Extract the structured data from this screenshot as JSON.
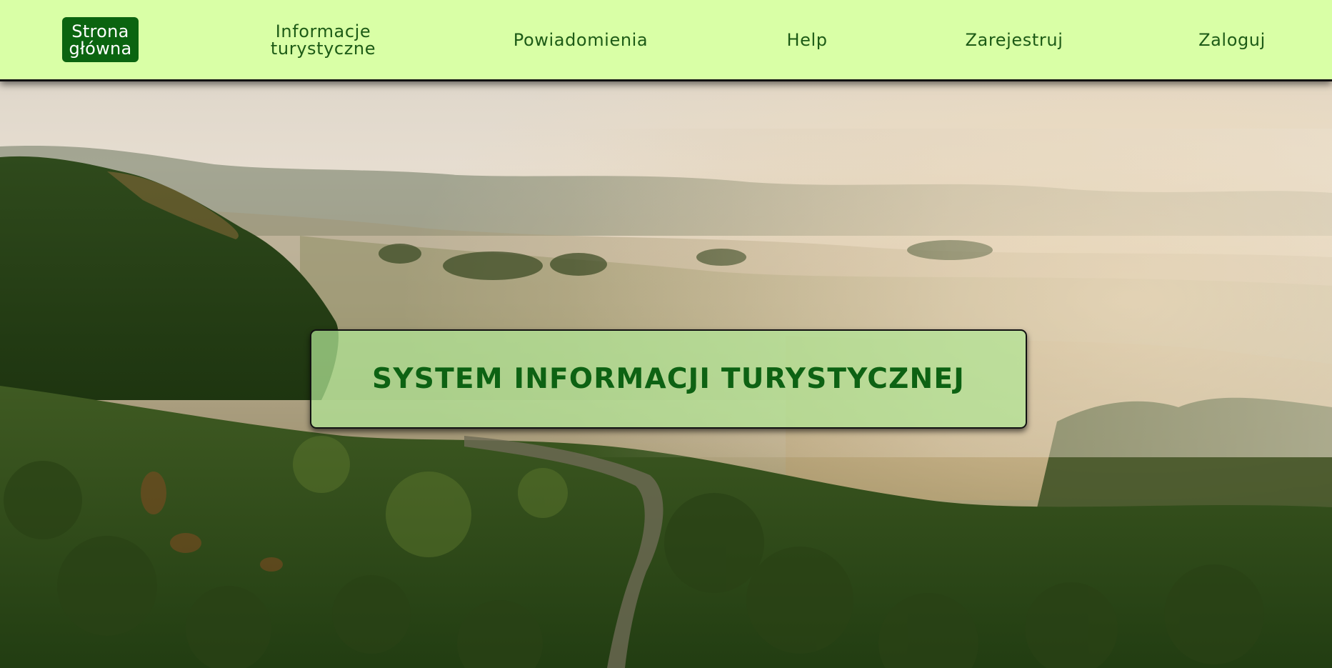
{
  "nav": {
    "home": "Strona\ngłówna",
    "tourist_info": "Informacje\nturystyczne",
    "notifications": "Powiadomienia",
    "help": "Help",
    "register": "Zarejestruj",
    "login": "Zaloguj"
  },
  "hero": {
    "title": "SYSTEM INFORMACJI TURYSTYCZNEJ"
  },
  "colors": {
    "navbar_bg": "#d9ffa6",
    "nav_text": "#1d5b16",
    "home_pill": "#0b6410",
    "banner_bg": "#b2e696",
    "title_text": "#0d6213"
  }
}
